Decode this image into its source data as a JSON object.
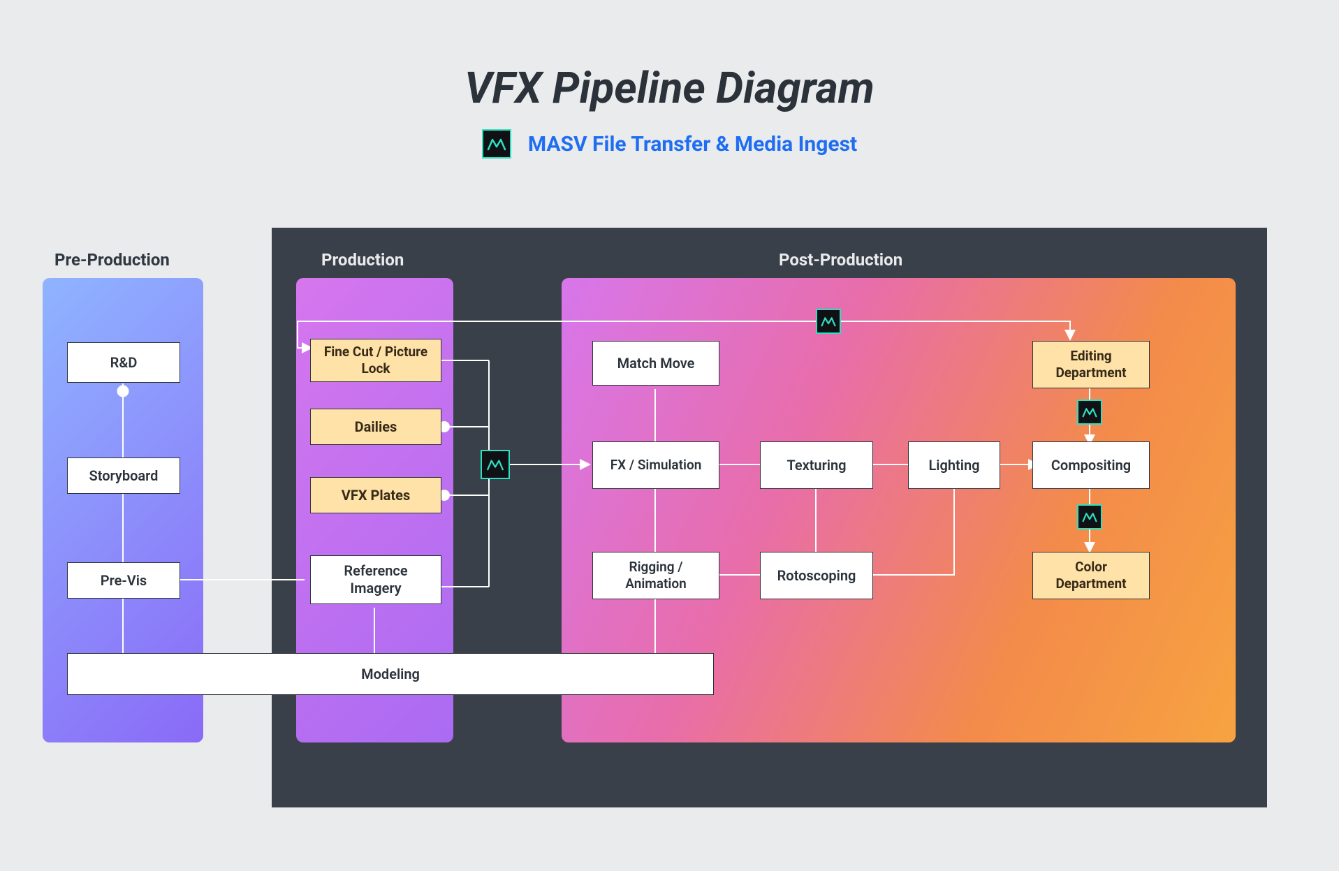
{
  "title": "VFX Pipeline Diagram",
  "subtitle": "MASV File Transfer & Media Ingest",
  "sections": {
    "pre": "Pre-Production",
    "prod": "Production",
    "post": "Post-Production"
  },
  "nodes": {
    "rnd": "R&D",
    "storyboard": "Storyboard",
    "previs": "Pre-Vis",
    "finecut": "Fine Cut / Picture Lock",
    "dailies": "Dailies",
    "vfxplates": "VFX Plates",
    "reference": "Reference Imagery",
    "modeling": "Modeling",
    "matchmove": "Match Move",
    "fxsim": "FX / Simulation",
    "rigging": "Rigging / Animation",
    "texturing": "Texturing",
    "rotoscoping": "Rotoscoping",
    "lighting": "Lighting",
    "editing": "Editing Department",
    "compositing": "Compositing",
    "color": "Color Department"
  },
  "icons": {
    "masv": "masv-logo"
  },
  "colors": {
    "bg": "#e9ebed",
    "dark": "#3a4049",
    "accent": "#1f6ef2",
    "beige": "#ffe2a8",
    "masv_border": "#2ee0c2"
  }
}
